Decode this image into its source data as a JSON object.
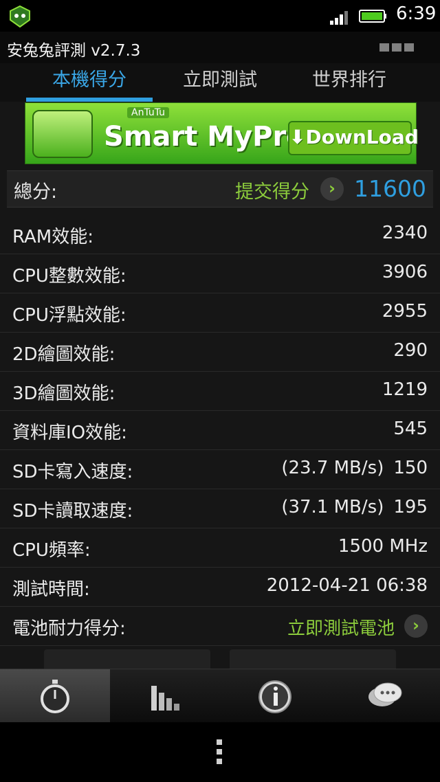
{
  "status": {
    "time": "6:39"
  },
  "app": {
    "title": "安兔兔評測 v2.7.3"
  },
  "tabs": [
    {
      "label": "本機得分",
      "active": true
    },
    {
      "label": "立即測試",
      "active": false
    },
    {
      "label": "世界排行",
      "active": false
    }
  ],
  "banner": {
    "brand": "AnTuTu",
    "text": "Smart MyProfile",
    "button": "DownLoad"
  },
  "total": {
    "label": "總分:",
    "submit_label": "提交得分",
    "score": "11600"
  },
  "rows": [
    {
      "label": "RAM效能:",
      "value": "2340"
    },
    {
      "label": "CPU整數效能:",
      "value": "3906"
    },
    {
      "label": "CPU浮點效能:",
      "value": "2955"
    },
    {
      "label": "2D繪圖效能:",
      "value": "290"
    },
    {
      "label": "3D繪圖效能:",
      "value": "1219"
    },
    {
      "label": "資料庫IO效能:",
      "value": "545"
    },
    {
      "label": "SD卡寫入速度:",
      "speed": "(23.7 MB/s)",
      "value": "150"
    },
    {
      "label": "SD卡讀取速度:",
      "speed": "(37.1 MB/s)",
      "value": "195"
    },
    {
      "label": "CPU頻率:",
      "value": "1500 MHz"
    },
    {
      "label": "測試時間:",
      "value": "2012-04-21 06:38"
    },
    {
      "label": "電池耐力得分:",
      "link": "立即測試電池"
    }
  ],
  "toolbar": [
    {
      "icon": "stopwatch-icon",
      "active": true
    },
    {
      "icon": "bar-chart-icon",
      "active": false
    },
    {
      "icon": "info-icon",
      "active": false
    },
    {
      "icon": "chat-bubbles-icon",
      "active": false
    }
  ],
  "colors": {
    "accent": "#2f9fe0",
    "link_green": "#8ccc3c",
    "banner_green": "#5fc22a"
  }
}
